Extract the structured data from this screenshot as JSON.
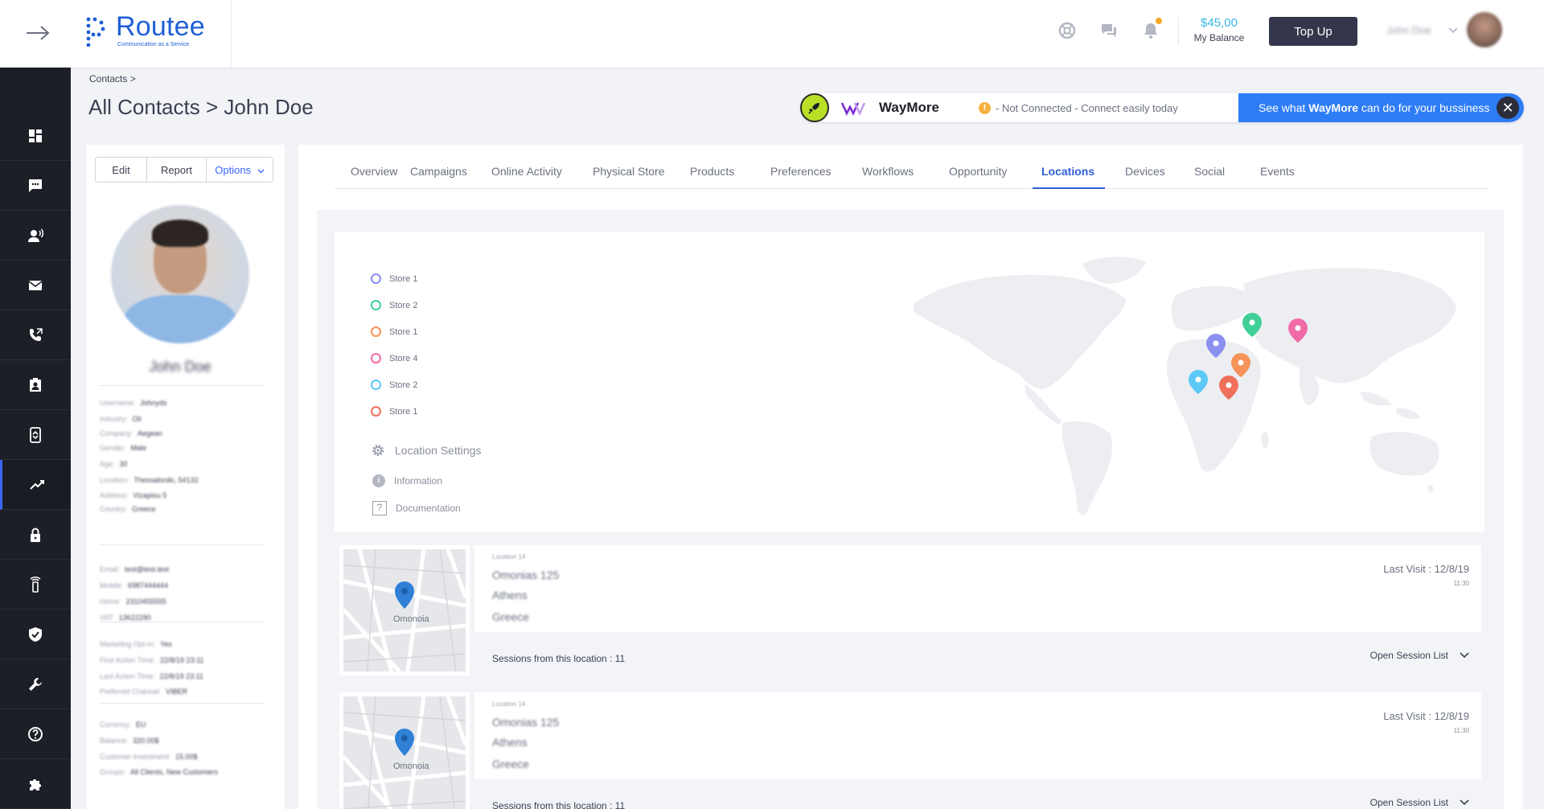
{
  "header": {
    "logo_text": "Routee",
    "logo_tagline": "Communication as a Service",
    "balance_amount": "$45,00",
    "balance_label": "My Balance",
    "topup_label": "Top Up",
    "user_name": "John Doe"
  },
  "sidebar": {
    "items": [
      {
        "icon": "dashboard-icon"
      },
      {
        "icon": "sms-icon"
      },
      {
        "icon": "voice-icon"
      },
      {
        "icon": "email-icon"
      },
      {
        "icon": "phone-icon"
      },
      {
        "icon": "contacts-icon"
      },
      {
        "icon": "campaigns-icon"
      },
      {
        "icon": "analytics-icon",
        "active": true
      },
      {
        "icon": "lock-icon"
      },
      {
        "icon": "device-icon"
      },
      {
        "icon": "shield-icon"
      },
      {
        "icon": "wrench-icon"
      },
      {
        "icon": "help-icon"
      },
      {
        "icon": "puzzle-icon"
      }
    ]
  },
  "breadcrumb": "Contacts >",
  "page_title": "All Contacts > John Doe",
  "waymore": {
    "name": "WayMore",
    "status": "- Not Connected - Connect easily today",
    "cta_prefix": "See what ",
    "cta_brand": "WayMore",
    "cta_suffix": " can do for your bussiness"
  },
  "profile": {
    "buttons": [
      "Edit",
      "Report",
      "Options"
    ],
    "name": "John Doe",
    "details": [
      {
        "label": "Username:",
        "value": "Johnyds"
      },
      {
        "label": "Industry:",
        "value": "Oil"
      },
      {
        "label": "Company:",
        "value": "Aegean"
      },
      {
        "label": "Gender:",
        "value": "Male"
      },
      {
        "label": "Age:",
        "value": "30"
      },
      {
        "label": "Location:",
        "value": "Thessaloniki, 54132"
      },
      {
        "label": "Address:",
        "value": "Vizapiou 5"
      },
      {
        "label": "Country:",
        "value": "Greece"
      },
      {
        "label": "Email:",
        "value": "test@test.test"
      },
      {
        "label": "Mobile:",
        "value": "6987444444"
      },
      {
        "label": "Home:",
        "value": "2310455555"
      },
      {
        "label": "VAT:",
        "value": "13622290"
      },
      {
        "label": "Marketing Opt-in:",
        "value": "Yes"
      },
      {
        "label": "First Action Time:",
        "value": "22/8/19 23:11"
      },
      {
        "label": "Last Action Time:",
        "value": "22/8/19 23:11"
      },
      {
        "label": "Preferred Channel:",
        "value": "VIBER"
      },
      {
        "label": "Currency:",
        "value": "EU"
      },
      {
        "label": "Balance:",
        "value": "320.00$"
      },
      {
        "label": "Customer Investment:",
        "value": "15.00$"
      },
      {
        "label": "Groups:",
        "value": "All Clients, New Customers"
      }
    ]
  },
  "tabs": [
    {
      "label": "Overview"
    },
    {
      "label": "Campaigns"
    },
    {
      "label": "Online Activity"
    },
    {
      "label": "Physical Store"
    },
    {
      "label": "Products"
    },
    {
      "label": "Preferences"
    },
    {
      "label": "Workflows"
    },
    {
      "label": "Opportunity"
    },
    {
      "label": "Locations",
      "active": true
    },
    {
      "label": "Devices"
    },
    {
      "label": "Social"
    },
    {
      "label": "Events"
    }
  ],
  "legend": [
    {
      "label": "Store 1",
      "color": "#8b8ff0"
    },
    {
      "label": "Store 2",
      "color": "#3fcf97"
    },
    {
      "label": "Store 1",
      "color": "#f6935a"
    },
    {
      "label": "Store 4",
      "color": "#f06aa8"
    },
    {
      "label": "Store 2",
      "color": "#5cc8f5"
    },
    {
      "label": "Store 1",
      "color": "#f0705c"
    }
  ],
  "location_settings_label": "Location Settings",
  "information_label": "Information",
  "documentation_label": "Documentation",
  "locations": [
    {
      "label": "Location 14",
      "street": "Omonias 125",
      "city": "Athens",
      "country": "Greece",
      "map_label": "Omonoia",
      "last_visit": "Last Visit : 12/8/19",
      "time": "11:30",
      "sessions": "Sessions from this location : 11",
      "open_label": "Open Session List"
    },
    {
      "label": "Location 14",
      "street": "Omonias 125",
      "city": "Athens",
      "country": "Greece",
      "map_label": "Omonoia",
      "last_visit": "Last Visit : 12/8/19",
      "time": "11:30",
      "sessions": "Sessions from this location : 11",
      "open_label": "Open Session List"
    }
  ]
}
